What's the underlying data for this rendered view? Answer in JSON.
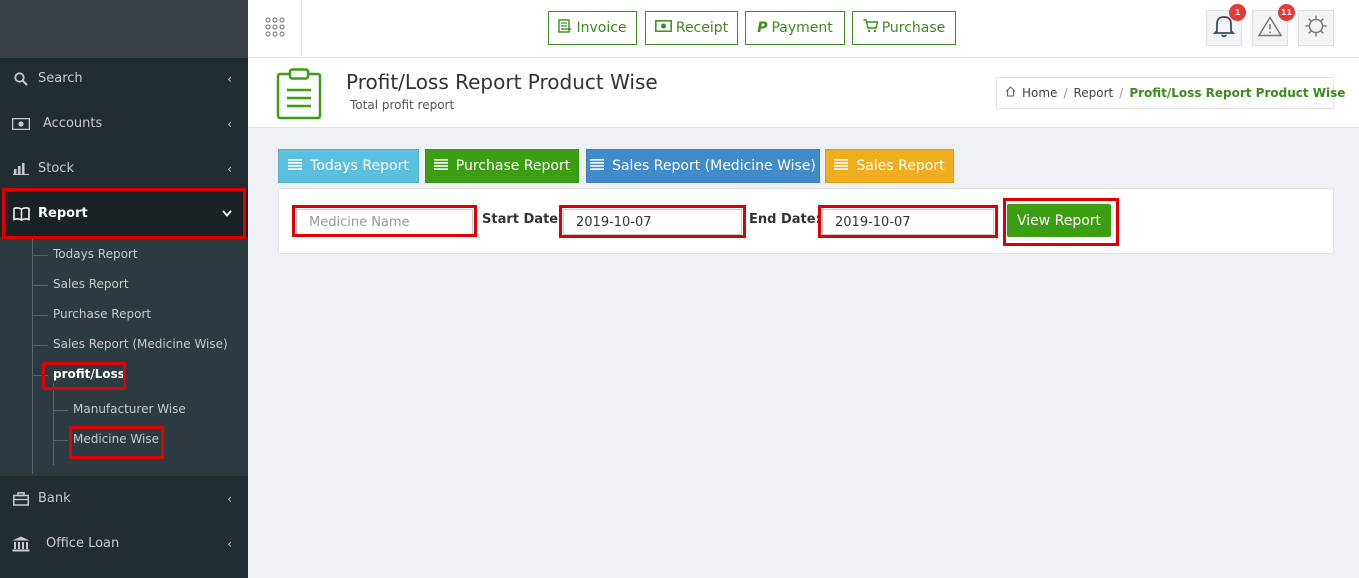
{
  "sidebar": {
    "items": [
      {
        "label": "Search",
        "icon": "search-icon"
      },
      {
        "label": "Accounts",
        "icon": "money-icon"
      },
      {
        "label": "Stock",
        "icon": "bar-chart-icon"
      },
      {
        "label": "Report",
        "icon": "book-icon"
      },
      {
        "label": "Bank",
        "icon": "briefcase-icon"
      },
      {
        "label": "Office Loan",
        "icon": "bank-icon"
      }
    ],
    "report_submenu": [
      "Todays Report",
      "Sales Report",
      "Purchase Report",
      "Sales Report (Medicine Wise)",
      "profit/Loss"
    ],
    "profit_loss_submenu": [
      "Manufacturer Wise",
      "Medicine Wise"
    ]
  },
  "topbar": {
    "buttons": [
      {
        "label": "Invoice",
        "icon": "invoice-icon"
      },
      {
        "label": "Receipt",
        "icon": "money-icon"
      },
      {
        "label": "Payment",
        "icon": "paypal-icon"
      },
      {
        "label": "Purchase",
        "icon": "cart-icon"
      }
    ],
    "notification_count": "1",
    "alert_count": "11"
  },
  "header": {
    "title": "Profit/Loss Report Product Wise",
    "subtitle": "Total profit report",
    "breadcrumb": {
      "home": "Home",
      "section": "Report",
      "current": "Profit/Loss Report Product Wise"
    }
  },
  "tabs": [
    {
      "label": "Todays Report",
      "color": "#5bc0de"
    },
    {
      "label": "Purchase Report",
      "color": "#3c9e12"
    },
    {
      "label": "Sales Report (Medicine Wise)",
      "color": "#428bca"
    },
    {
      "label": "Sales Report",
      "color": "#f0ad1e"
    }
  ],
  "filter": {
    "medicine_placeholder": "Medicine Name",
    "start_label": "Start Date:",
    "start_value": "2019-10-07",
    "end_label": "End Date:",
    "end_value": "2019-10-07",
    "submit_label": "View Report"
  },
  "colors": {
    "accent": "#3c8c1e",
    "sidebar_bg": "#222d32",
    "highlight": "#e00000"
  }
}
